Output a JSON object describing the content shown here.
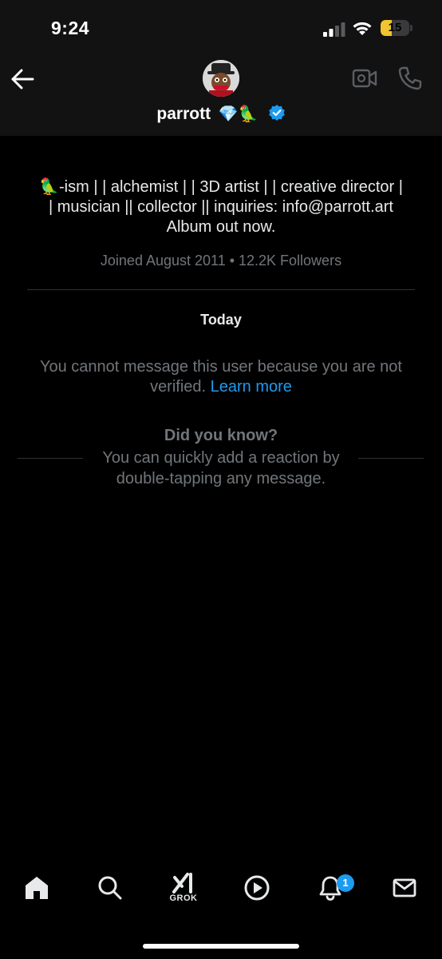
{
  "status_bar": {
    "time": "9:24",
    "battery_level": "15",
    "battery_fraction": 0.15
  },
  "header": {
    "display_name": "parrott",
    "name_emojis": "💎🦜",
    "back_icon": "arrow-left-icon",
    "video_icon": "video-call-icon",
    "phone_icon": "phone-call-icon"
  },
  "profile": {
    "bio_line1": "🦜-ism | | alchemist | | 3D artist | | creative director |",
    "bio_line2": "| musician || collector || inquiries: info@parrott.art",
    "bio_line3": "Album out now.",
    "joined": "Joined August 2011 • 12.2K Followers"
  },
  "conversation": {
    "date_label": "Today",
    "notice_text": "You cannot message this user because you are not verified.",
    "notice_link": "Learn more",
    "tip_title": "Did you know?",
    "tip_line1": "You can quickly add a reaction by",
    "tip_line2": "double-tapping any message."
  },
  "bottom_nav": {
    "items": [
      "home-icon",
      "search-icon",
      "grok-icon",
      "video-play-icon",
      "notifications-icon",
      "messages-icon"
    ],
    "grok_label": "GROK",
    "notification_badge": "1"
  },
  "colors": {
    "accent": "#1d9bf0",
    "secondary_text": "#71767b",
    "header_bg": "#121212",
    "battery_low": "#f0c52f"
  }
}
